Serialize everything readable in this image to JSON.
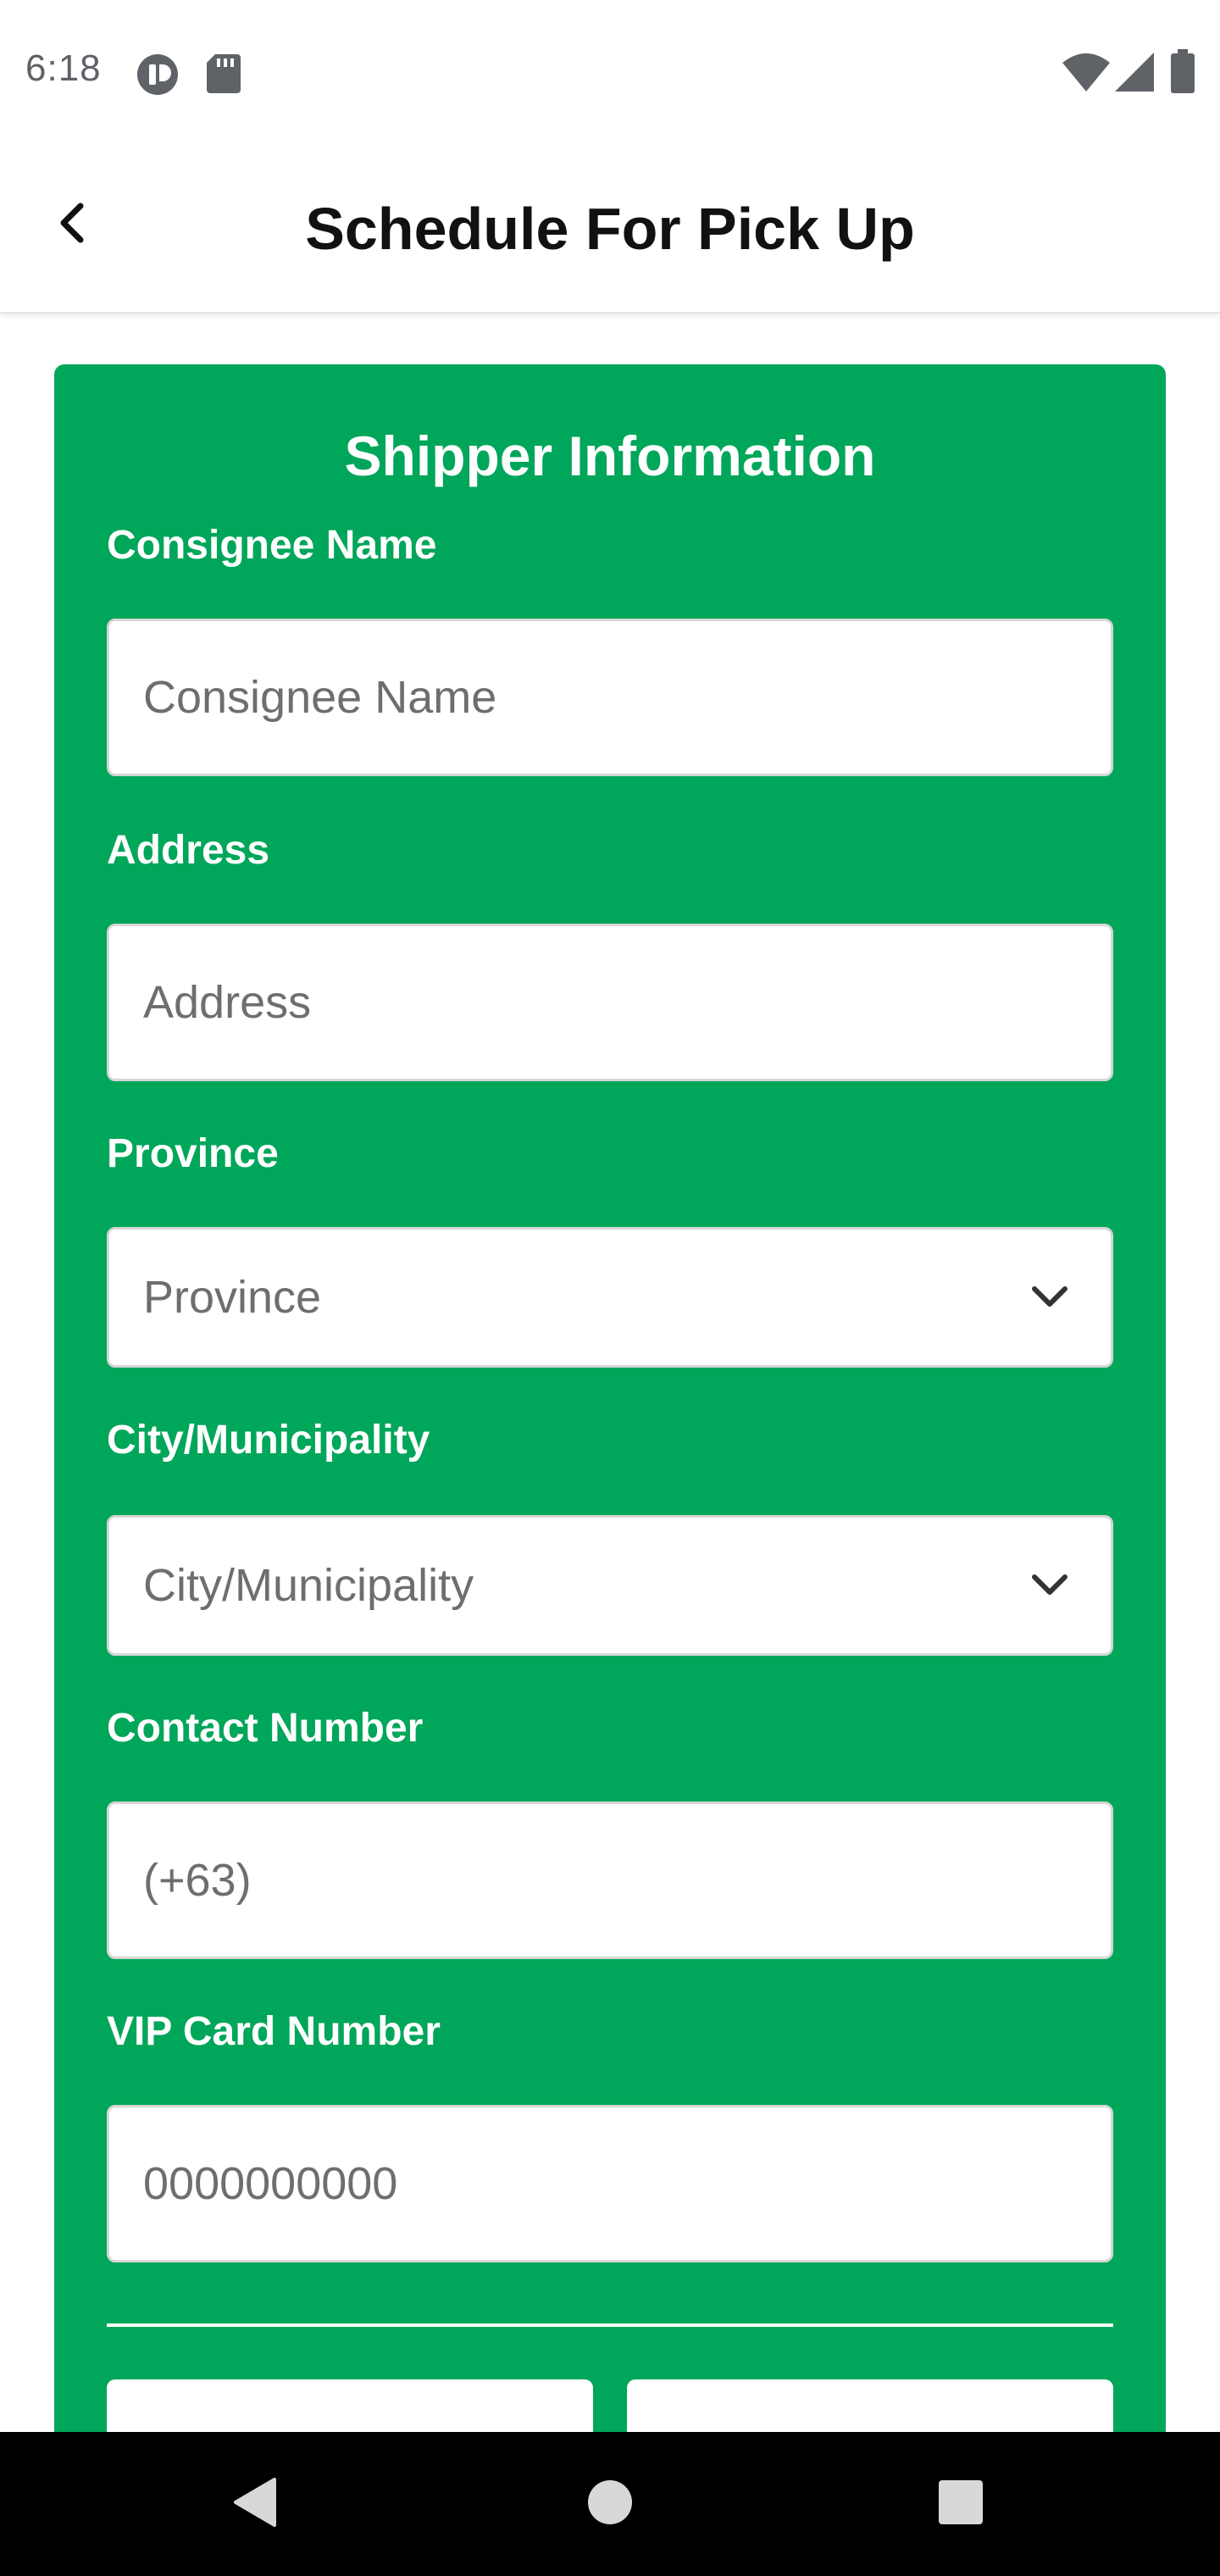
{
  "status_bar": {
    "time": "6:18",
    "left_icons": [
      "app-notification-icon",
      "sd-card-icon"
    ],
    "right_icons": [
      "wifi-icon",
      "cell-signal-icon",
      "battery-icon"
    ]
  },
  "app_bar": {
    "title": "Schedule For Pick Up",
    "back_icon": "back-arrow-icon"
  },
  "card": {
    "title": "Shipper Information",
    "background": "#00a65a",
    "fields": {
      "consignee_name": {
        "label": "Consignee Name",
        "placeholder": "Consignee Name",
        "value": ""
      },
      "address": {
        "label": "Address",
        "placeholder": "Address",
        "value": ""
      },
      "province": {
        "label": "Province",
        "selected": "Province"
      },
      "city": {
        "label": "City/Municipality",
        "selected": "City/Municipality"
      },
      "contact_number": {
        "label": "Contact Number",
        "placeholder": "(+63)",
        "value": ""
      },
      "vip_card": {
        "label": "VIP Card Number",
        "placeholder": "0000000000",
        "value": ""
      }
    }
  },
  "nav_bar": {
    "icons": [
      "nav-back-icon",
      "nav-home-icon",
      "nav-recents-icon"
    ]
  }
}
